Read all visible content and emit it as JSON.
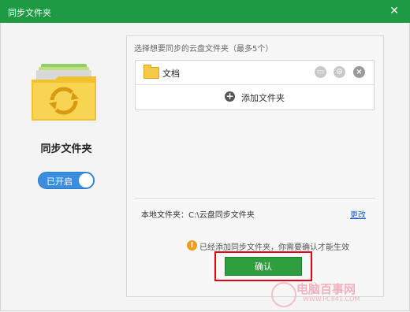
{
  "window": {
    "title": "同步文件夹",
    "close_glyph": "✕"
  },
  "left": {
    "title": "同步文件夹",
    "toggle_label": "已开启",
    "toggle_state": "on"
  },
  "panel": {
    "hint": "选择想要同步的云盘文件夹（最多5个）",
    "folders": [
      {
        "label": "文档"
      }
    ],
    "add_label": "添加文件夹",
    "local_label": "本地文件夹：C:\\云盘同步文件夹",
    "change_label": "更改"
  },
  "notice": {
    "text": "已经添加同步文件夹，你需要确认才能生效",
    "icon": "info-icon"
  },
  "confirm_label": "确认",
  "watermark": {
    "line1": "电脑百事网",
    "line2": "WWW.PC841.COM"
  },
  "colors": {
    "titlebar": "#1e9b42",
    "confirm": "#2f9e3f",
    "highlight": "#e60012",
    "toggle": "#3b8de0",
    "link": "#1e60c2"
  }
}
